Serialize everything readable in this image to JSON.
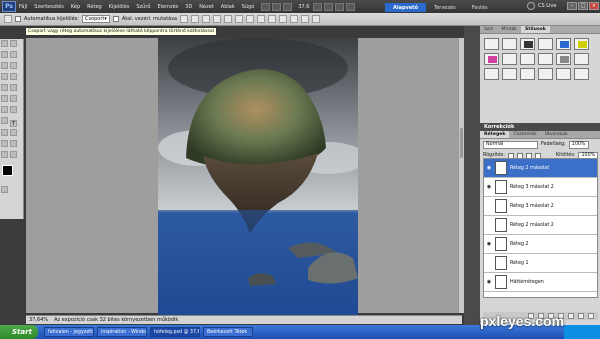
{
  "app": {
    "logo": "Ps"
  },
  "menu": [
    "Fájl",
    "Szerkesztés",
    "Kép",
    "Réteg",
    "Kijelölés",
    "Szűrő",
    "Elemzés",
    "3D",
    "Nézet",
    "Ablak",
    "Súgó"
  ],
  "zoom": "37,6",
  "workspaces": [
    {
      "label": "Alapvető",
      "active": true
    },
    {
      "label": "Tervezés",
      "active": false
    },
    {
      "label": "Festés",
      "active": false
    }
  ],
  "cslive": "CS Live",
  "options": {
    "auto_select_label": "Automatikus kijelölés:",
    "auto_select_value": "Csoport",
    "transform_label": "Átal. vezérl. mutatása"
  },
  "tooltip": "Csoport vagy réteg automatikus kijelölése látható képpontra történő kattintással",
  "status": {
    "zoom": "37,64%",
    "info": "Az expozíció csak 32 bites környezetben működik"
  },
  "panels": {
    "top_tabs": [
      "Szín",
      "Minták",
      "Stílusok"
    ],
    "style_colors": [
      "#f0f0f0",
      "#f0f0f0",
      "#333333",
      "#f0f0f0",
      "#2a6ad0",
      "#d0d000",
      "#d040a0",
      "#f0f0f0",
      "#f0f0f0",
      "#f0f0f0",
      "#888888",
      "#f0f0f0",
      "#f0f0f0",
      "#f0f0f0",
      "#f0f0f0",
      "#f0f0f0",
      "#f0f0f0",
      "#f0f0f0"
    ],
    "adjust_title": "Korrekciók",
    "layers_tabs": [
      "Rétegek",
      "Csatornák",
      "Útvonalak"
    ],
    "blend_mode": "Normál",
    "opacity_label": "Fedetlség:",
    "opacity_value": "100%",
    "lock_label": "Rögzítés:",
    "fill_label": "Kitöltés:",
    "fill_value": "100%",
    "layers": [
      {
        "name": "Réteg 2 másolat",
        "selected": true,
        "visible": true
      },
      {
        "name": "Réteg 3 másolat 2",
        "selected": false,
        "visible": true
      },
      {
        "name": "Réteg 3 másolat 2",
        "selected": false,
        "visible": false
      },
      {
        "name": "Réteg 2 másolat 2",
        "selected": false,
        "visible": false
      },
      {
        "name": "Réteg 2",
        "selected": false,
        "visible": true
      },
      {
        "name": "Réteg 1",
        "selected": false,
        "visible": false
      },
      {
        "name": "Háttérrétegen",
        "selected": false,
        "visible": true
      }
    ]
  },
  "taskbar": {
    "start": "Start",
    "tasks": [
      {
        "label": "fahvalen - Jegyzettömb",
        "active": false
      },
      {
        "label": "inspiration - Windows ...",
        "active": false
      },
      {
        "label": "hófeleg.psd @ 37,6% (...",
        "active": true
      },
      {
        "label": "Beérkezett Tétek",
        "active": false
      }
    ]
  },
  "watermark": "pxleyes.com"
}
